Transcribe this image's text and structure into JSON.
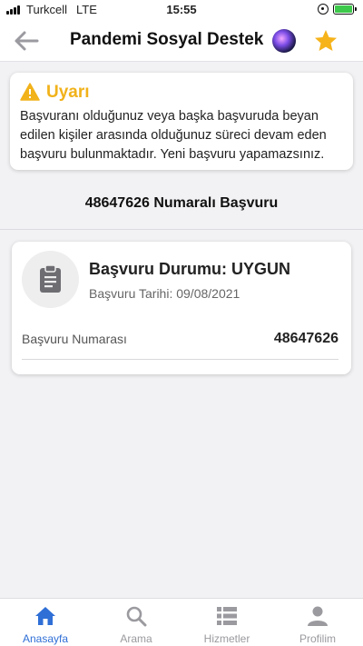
{
  "status_bar": {
    "carrier": "Turkcell",
    "network": "LTE",
    "time": "15:55",
    "battery_level": 0.9,
    "colors": {
      "battery": "#3dc94b"
    }
  },
  "nav": {
    "title": "Pandemi Sosyal Destek",
    "icons": [
      "back-arrow-icon",
      "siri-icon",
      "star-icon"
    ],
    "colors": {
      "star": "#f6b31a",
      "back": "#9a9aa0"
    }
  },
  "alert": {
    "title": "Uyarı",
    "message": "Başvuranı olduğunuz veya başka başvuruda beyan edilen kişiler arasında olduğunuz süreci devam eden başvuru bulunmaktadır. Yeni başvuru yapamazsınız.",
    "icon": "warning-icon",
    "color": "#f1b21a"
  },
  "application": {
    "heading": "48647626 Numaralı Başvuru",
    "status_title": "Başvuru Durumu: UYGUN",
    "date": "Başvuru Tarihi: 09/08/2021",
    "number_label": "Başvuru Numarası",
    "number_value": "48647626",
    "icon": "clipboard-icon"
  },
  "tabs": [
    {
      "label": "Anasayfa",
      "icon": "home-icon",
      "active": true
    },
    {
      "label": "Arama",
      "icon": "search-icon",
      "active": false
    },
    {
      "label": "Hizmetler",
      "icon": "list-icon",
      "active": false
    },
    {
      "label": "Profilim",
      "icon": "person-icon",
      "active": false
    }
  ],
  "colors": {
    "accent": "#2f6fd6",
    "inactive_tab": "#9a9a9f"
  }
}
